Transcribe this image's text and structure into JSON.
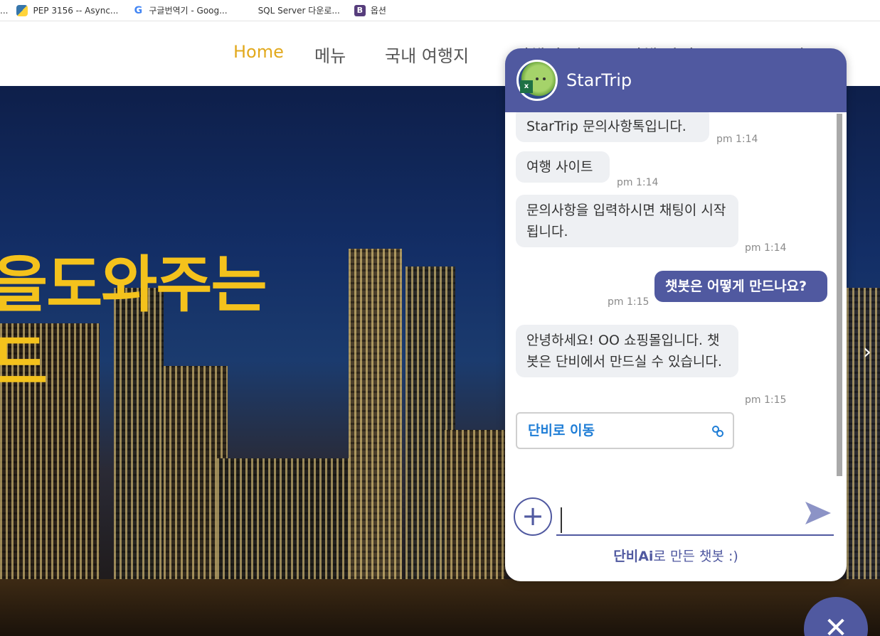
{
  "bookmarks": [
    {
      "icon": "python-icon",
      "label": "PEP 3156 -- Async..."
    },
    {
      "icon": "google-translate-icon",
      "label": "구글번역기 - Goog..."
    },
    {
      "icon": "microsoft-icon",
      "label": "SQL Server 다운로..."
    },
    {
      "icon": "bootstrap-icon",
      "label": "옵션"
    }
  ],
  "nav": {
    "items": [
      "Home",
      "메뉴",
      "국내 여행지",
      "여행 후기",
      "여행 가이드",
      "로그인"
    ],
    "active": "Home",
    "active_color": "#e2a91d"
  },
  "hero": {
    "title_line1": "을도와주는",
    "title_line2": "드",
    "title_color": "#f4c21c"
  },
  "chat": {
    "title": "StarTrip",
    "accent_color": "#5059a0",
    "messages": [
      {
        "from": "bot",
        "text": "StarTrip 문의사항톡입니다.",
        "time": "pm 1:14"
      },
      {
        "from": "bot",
        "text": "여행 사이트",
        "time": "pm 1:14"
      },
      {
        "from": "bot",
        "text": "문의사항을 입력하시면 채팅이 시작됩니다.",
        "time": "pm 1:14"
      },
      {
        "from": "user",
        "text": "챗봇은 어떻게 만드나요?",
        "time": "pm 1:15"
      },
      {
        "from": "bot",
        "text": "안녕하세요! OO 쇼핑몰입니다. 챗봇은 단비에서 만드실 수 있습니다.",
        "time": "pm 1:15"
      }
    ],
    "link_button": "단비로 이동",
    "input_value": "",
    "footer_brand": "단비Ai",
    "footer_text": "로 만든 챗봇 :)"
  }
}
